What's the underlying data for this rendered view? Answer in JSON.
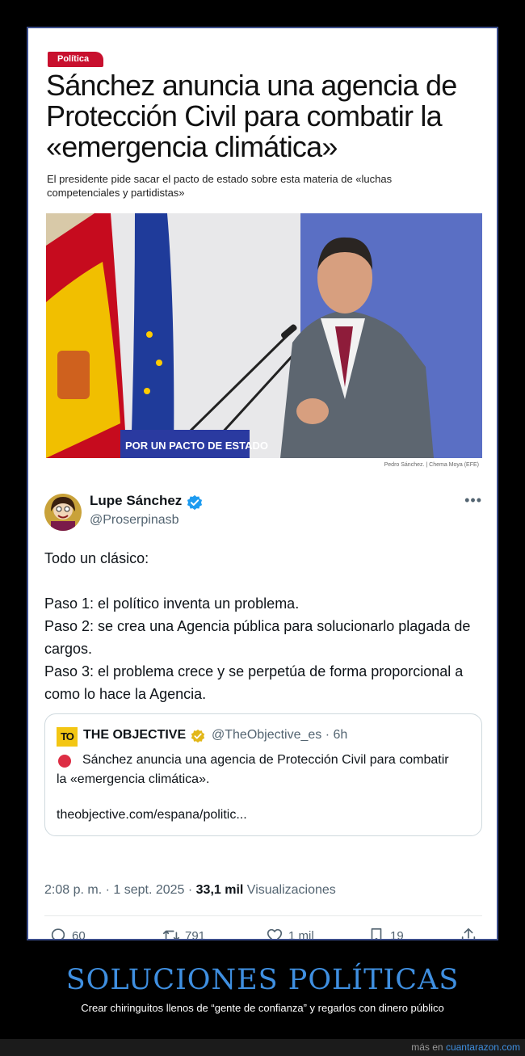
{
  "article": {
    "section": "Política",
    "headline": "Sánchez anuncia una agencia de Protección Civil para combatir la «emergencia climática»",
    "subhead": "El presidente pide sacar el pacto de estado sobre esta materia de «luchas competenciales y partidistas»",
    "photo_banner": "POR UN PACTO DE ESTADO",
    "photo_caption": "Pedro Sánchez. | Chema Moya (EFE)"
  },
  "tweet": {
    "author_name": "Lupe Sánchez",
    "author_handle": "@Proserpinasb",
    "more_icon": "more-horizontal-icon",
    "body_lines": [
      "Todo un clásico:",
      "",
      "Paso 1: el político inventa un problema.",
      "Paso 2: se crea una Agencia pública para solucionarlo plagada de cargos.",
      "Paso 3: el problema crece y se perpetúa de forma proporcional a como lo hace la Agencia."
    ],
    "quote": {
      "logo": "TO",
      "name": "THE OBJECTIVE",
      "handle_time": "@TheObjective_es · 6h",
      "text": "Sánchez anuncia una agencia de Protección Civil para combatir la «emergencia climática».",
      "link": "theobjective.com/espana/politic..."
    },
    "timestamp": "2:08 p. m. · 1 sept. 2025 · ",
    "views_count": "33,1 mil",
    "views_label": " Visualizaciones",
    "stats": {
      "replies": "60",
      "retweets": "791",
      "likes": "1 mil",
      "bookmarks": "19"
    }
  },
  "footer": {
    "title": "SOLUCIONES POLÍTICAS",
    "subtitle": "Crear chiringuitos llenos de “gente de confianza” y regarlos con dinero público",
    "credit_prefix": "más en ",
    "credit_site": "cuantarazon.com"
  },
  "colors": {
    "badge_red": "#c8102e",
    "verified_blue": "#1d9bf0",
    "verified_gold": "#e2b719",
    "footer_title_blue": "#3f8fe0",
    "card_border": "#3b4d8a"
  }
}
